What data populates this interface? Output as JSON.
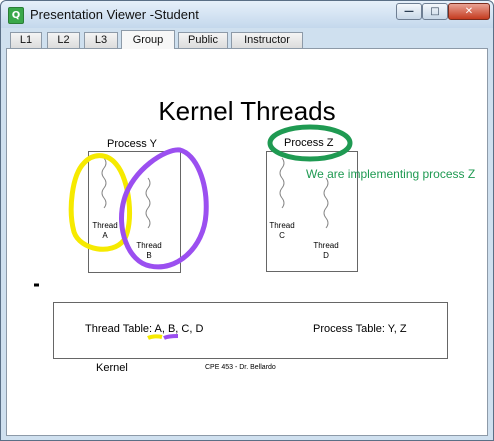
{
  "window": {
    "title": "Presentation Viewer -Student",
    "app_icon_letter": "Q",
    "controls": {
      "minimize": "—",
      "maximize": "□",
      "close": "✕"
    }
  },
  "tabs": [
    {
      "label": "L1"
    },
    {
      "label": "L2"
    },
    {
      "label": "L3"
    },
    {
      "label": "Group",
      "active": true
    },
    {
      "label": "Public"
    },
    {
      "label": "Instructor"
    }
  ],
  "slide": {
    "title": "Kernel Threads",
    "process_y": {
      "label": "Process Y",
      "threads": [
        {
          "line1": "Thread",
          "line2": "A"
        },
        {
          "line1": "Thread",
          "line2": "B"
        }
      ]
    },
    "process_z": {
      "label": "Process Z",
      "threads": [
        {
          "line1": "Thread",
          "line2": "C"
        },
        {
          "line1": "Thread",
          "line2": "D"
        }
      ]
    },
    "annotation": "We are implementing process Z",
    "thread_table": "Thread Table: A, B, C, D",
    "process_table": "Process Table: Y, Z",
    "kernel_label": "Kernel",
    "footer": "CPE 453 - Dr. Bellardo"
  },
  "colors": {
    "highlight_yellow": "#f6ea00",
    "highlight_purple": "#9b4ff0",
    "highlight_green": "#1f9a52"
  }
}
